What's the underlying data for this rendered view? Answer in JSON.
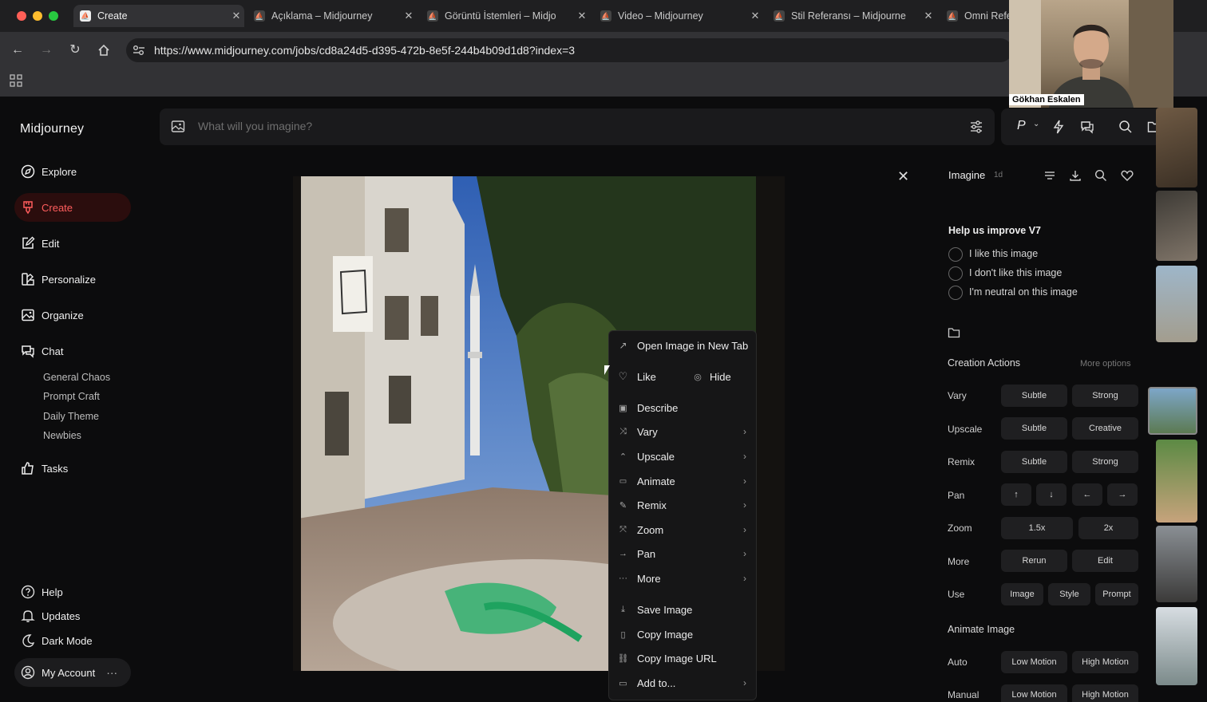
{
  "browser": {
    "tabs": [
      {
        "title": "Create",
        "active": true
      },
      {
        "title": "Açıklama – Midjourney"
      },
      {
        "title": "Görüntü İstemleri – Midjo"
      },
      {
        "title": "Video – Midjourney"
      },
      {
        "title": "Stil Referansı – Midjourne"
      },
      {
        "title": "Omni Refe"
      }
    ],
    "url": "https://www.midjourney.com/jobs/cd8a24d5-d395-472b-8e5f-244b4b09d1d8?index=3",
    "colors": {
      "close": "#ff5f57",
      "minimize": "#febc2e",
      "maximize": "#28c840"
    }
  },
  "video_overlay": {
    "name": "Gökhan Eskalen"
  },
  "sidebar": {
    "brand": "Midjourney",
    "nav": [
      {
        "label": "Explore",
        "icon": "compass-icon"
      },
      {
        "label": "Create",
        "icon": "brush-icon",
        "active": true
      },
      {
        "label": "Edit",
        "icon": "edit-icon"
      },
      {
        "label": "Personalize",
        "icon": "palette-icon"
      },
      {
        "label": "Organize",
        "icon": "image-icon"
      },
      {
        "label": "Chat",
        "icon": "chat-icon"
      }
    ],
    "chat_rooms": [
      "General Chaos",
      "Prompt Craft",
      "Daily Theme",
      "Newbies"
    ],
    "tasks": "Tasks",
    "bottom": [
      {
        "label": "Help",
        "icon": "help-icon"
      },
      {
        "label": "Updates",
        "icon": "bell-icon"
      },
      {
        "label": "Dark Mode",
        "icon": "moon-icon"
      }
    ],
    "account": "My Account",
    "accent": "#ff5d5d"
  },
  "prompt_bar": {
    "placeholder": "What will you imagine?",
    "version_badge": "P"
  },
  "context_menu": {
    "items": [
      {
        "label": "Open Image in New Tab",
        "icon": "external-link-icon"
      },
      {
        "label": "Like",
        "icon": "heart-icon"
      },
      {
        "label": "Hide",
        "icon": "eye-icon"
      },
      {
        "label": "Describe",
        "icon": "describe-icon"
      },
      {
        "label": "Vary",
        "icon": "shuffle-icon",
        "submenu": true
      },
      {
        "label": "Upscale",
        "icon": "upscale-icon",
        "submenu": true
      },
      {
        "label": "Animate",
        "icon": "video-icon",
        "submenu": true
      },
      {
        "label": "Remix",
        "icon": "pencil-icon",
        "submenu": true
      },
      {
        "label": "Zoom",
        "icon": "zoom-icon",
        "submenu": true
      },
      {
        "label": "Pan",
        "icon": "arrow-right-icon",
        "submenu": true
      },
      {
        "label": "More",
        "icon": "ellipsis-icon",
        "submenu": true
      },
      {
        "label": "Save Image",
        "icon": "download-icon"
      },
      {
        "label": "Copy Image",
        "icon": "clipboard-icon"
      },
      {
        "label": "Copy Image URL",
        "icon": "link-icon"
      },
      {
        "label": "Add to...",
        "icon": "folder-icon",
        "submenu": true
      }
    ]
  },
  "panel": {
    "title": "Imagine",
    "age": "1d",
    "feedback_title": "Help us improve V7",
    "feedback_options": [
      "I like this image",
      "I don't like this image",
      "I'm neutral on this image"
    ],
    "actions_title": "Creation Actions",
    "more_options": "More options",
    "rows": [
      {
        "label": "Vary",
        "buttons": [
          "Subtle",
          "Strong"
        ]
      },
      {
        "label": "Upscale",
        "buttons": [
          "Subtle",
          "Creative"
        ]
      },
      {
        "label": "Remix",
        "buttons": [
          "Subtle",
          "Strong"
        ]
      },
      {
        "label": "Pan",
        "buttons": [
          "↑",
          "↓",
          "←",
          "→"
        ]
      },
      {
        "label": "Zoom",
        "buttons": [
          "1.5x",
          "2x"
        ]
      },
      {
        "label": "More",
        "buttons": [
          "Rerun",
          "Edit"
        ]
      },
      {
        "label": "Use",
        "buttons": [
          "Image",
          "Style",
          "Prompt"
        ]
      }
    ],
    "animate_title": "Animate Image",
    "animate_rows": [
      {
        "label": "Auto",
        "buttons": [
          "Low Motion",
          "High Motion"
        ]
      },
      {
        "label": "Manual",
        "buttons": [
          "Low Motion",
          "High Motion"
        ]
      }
    ]
  }
}
